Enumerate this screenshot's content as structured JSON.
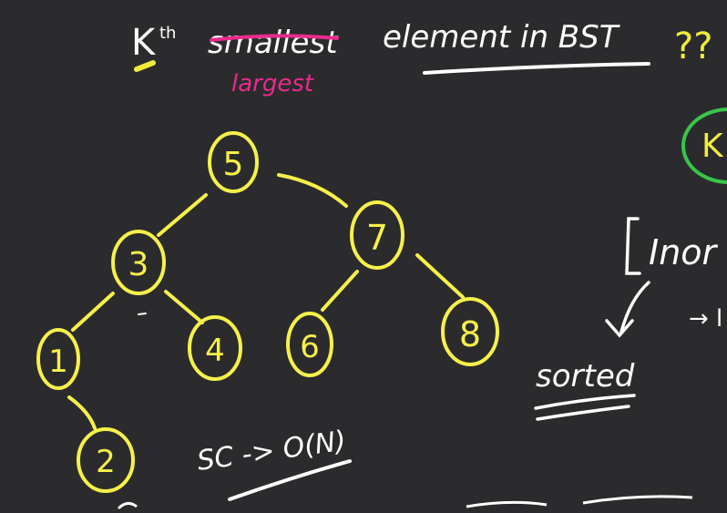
{
  "title": {
    "k_main": "K",
    "k_super": "th",
    "struck_word": "smallest",
    "replacement_word": "largest",
    "rest": "element in BST",
    "question_marks": "??"
  },
  "tree": {
    "node_labels": [
      "5",
      "3",
      "7",
      "1",
      "4",
      "6",
      "8",
      "2"
    ]
  },
  "notes": {
    "inorder_label": "Inor",
    "sorted_label": "sorted",
    "side_label_k": "K",
    "space_complexity": "SC -> O(N)"
  },
  "colors": {
    "board": "#2b2b2d",
    "chalk": "#ffffff",
    "node": "#f7f04a",
    "highlight": "#f1ec3a",
    "strike": "#ea2a8c",
    "green": "#39c54a"
  }
}
